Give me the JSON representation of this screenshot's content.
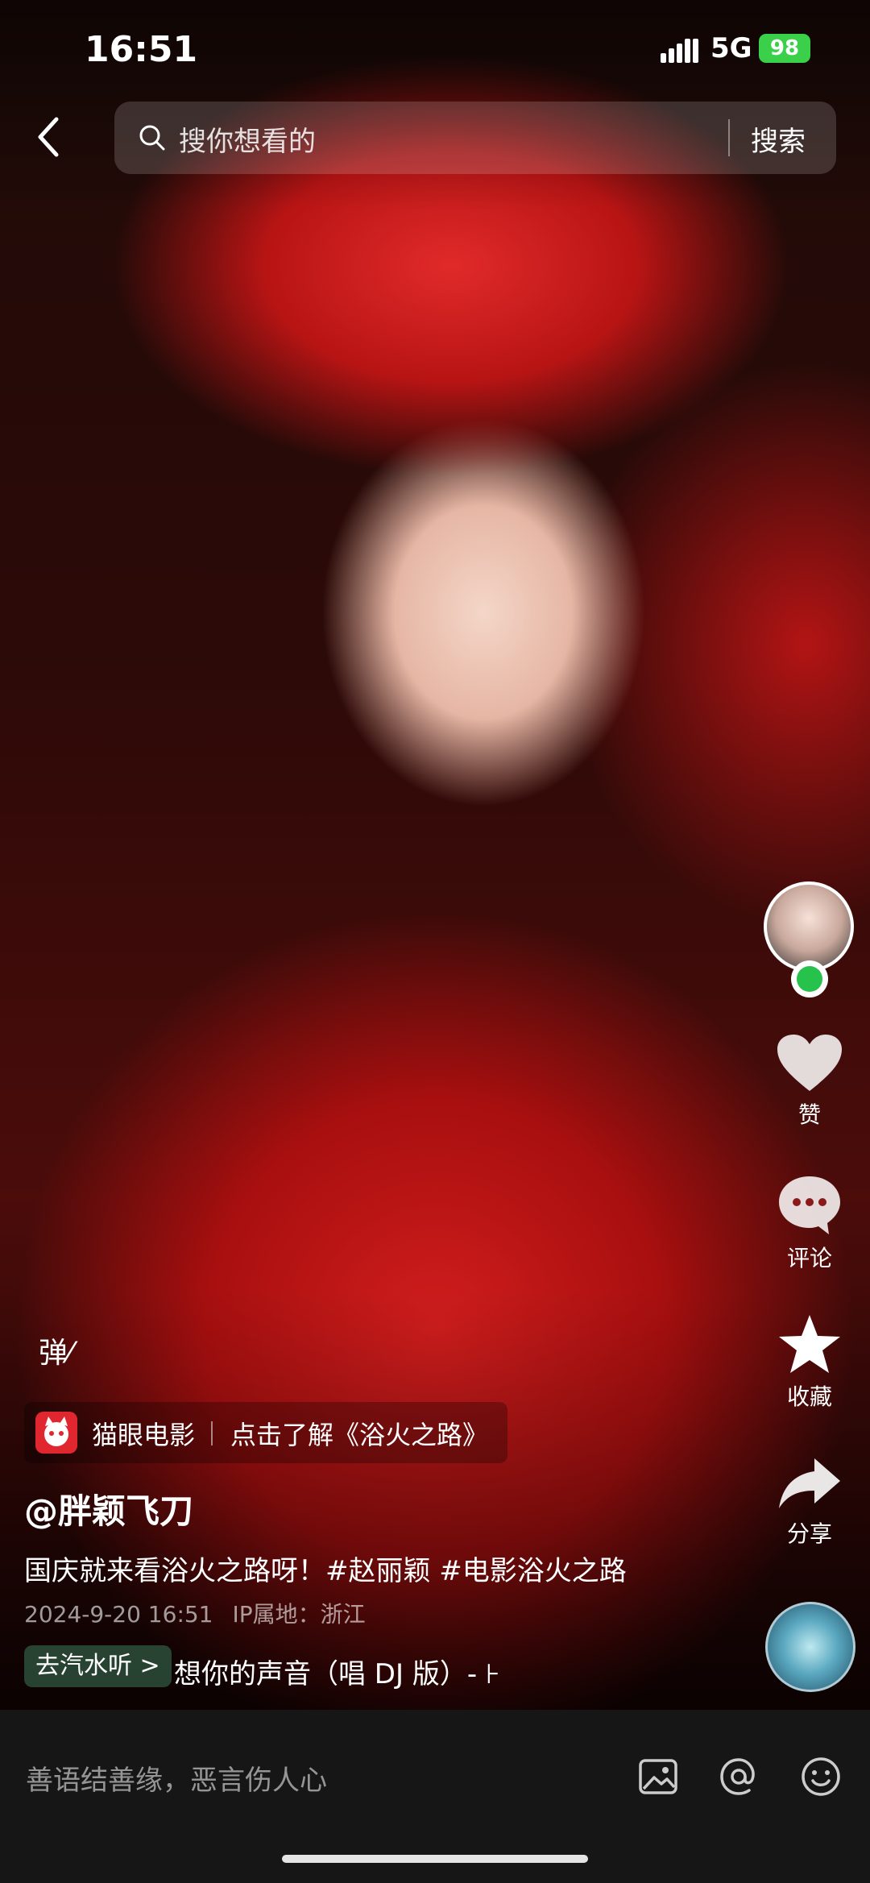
{
  "status_bar": {
    "time": "16:51",
    "network": "5G",
    "battery": "98"
  },
  "search": {
    "placeholder": "搜你想看的",
    "button": "搜索"
  },
  "rail": {
    "like_label": "赞",
    "comment_label": "评论",
    "favorite_label": "收藏",
    "share_label": "分享"
  },
  "danmaku": {
    "label": "弹"
  },
  "promo": {
    "brand": "猫眼电影",
    "link": "点击了解《浴火之路》"
  },
  "post": {
    "author": "@胖颖飞刀",
    "caption": "国庆就来看浴火之路呀！#赵丽颖 #电影浴火之路",
    "date": "2024-9-20 16:51",
    "ip": "IP属地：浙江"
  },
  "music": {
    "tag": "去汽水听 >",
    "title": "想你的声音（唱 DJ 版）- ⊦"
  },
  "comment_bar": {
    "placeholder": "善语结善缘，恶言伤人心"
  },
  "icons": {
    "back": "chevron-left-icon",
    "search": "search-icon",
    "like": "heart-icon",
    "comment": "speech-bubble-icon",
    "favorite": "star-icon",
    "share": "share-arrow-icon",
    "image": "image-icon",
    "mention": "at-icon",
    "emoji": "smile-icon"
  },
  "colors": {
    "battery": "#3ad04a",
    "follow_badge": "#27c24c",
    "promo_logo": "#e0262e"
  }
}
